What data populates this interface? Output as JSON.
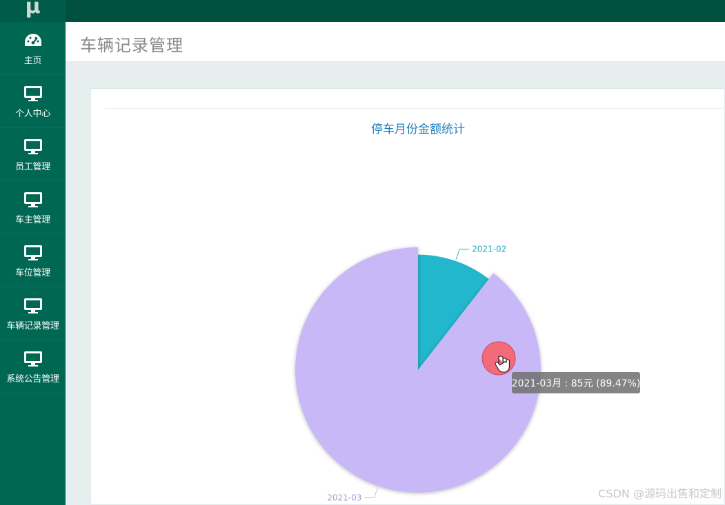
{
  "app": {
    "logo_text": "μ"
  },
  "sidebar": {
    "items": [
      {
        "label": "主页",
        "icon": "dashboard-icon"
      },
      {
        "label": "个人中心",
        "icon": "monitor-icon"
      },
      {
        "label": "员工管理",
        "icon": "monitor-icon"
      },
      {
        "label": "车主管理",
        "icon": "monitor-icon"
      },
      {
        "label": "车位管理",
        "icon": "monitor-icon"
      },
      {
        "label": "车辆记录管理",
        "icon": "monitor-icon"
      },
      {
        "label": "系统公告管理",
        "icon": "monitor-icon"
      }
    ]
  },
  "page": {
    "title": "车辆记录管理"
  },
  "watermark": "CSDN @源码出售和定制",
  "colors": {
    "sidebar": "#006752",
    "topbar": "#00503f",
    "slice_a": "#22b7cc",
    "slice_b": "#c8b8f7",
    "title": "#1e7fb8"
  },
  "chart_data": {
    "type": "pie",
    "title": "停车月份金额统计",
    "slices": [
      {
        "label": "2021-02",
        "value": 10,
        "color": "#22b7cc"
      },
      {
        "label": "2021-03",
        "value": 85,
        "color": "#c8b8f7"
      }
    ],
    "tooltip": "2021-03月 : 85元 (89.47%)"
  }
}
